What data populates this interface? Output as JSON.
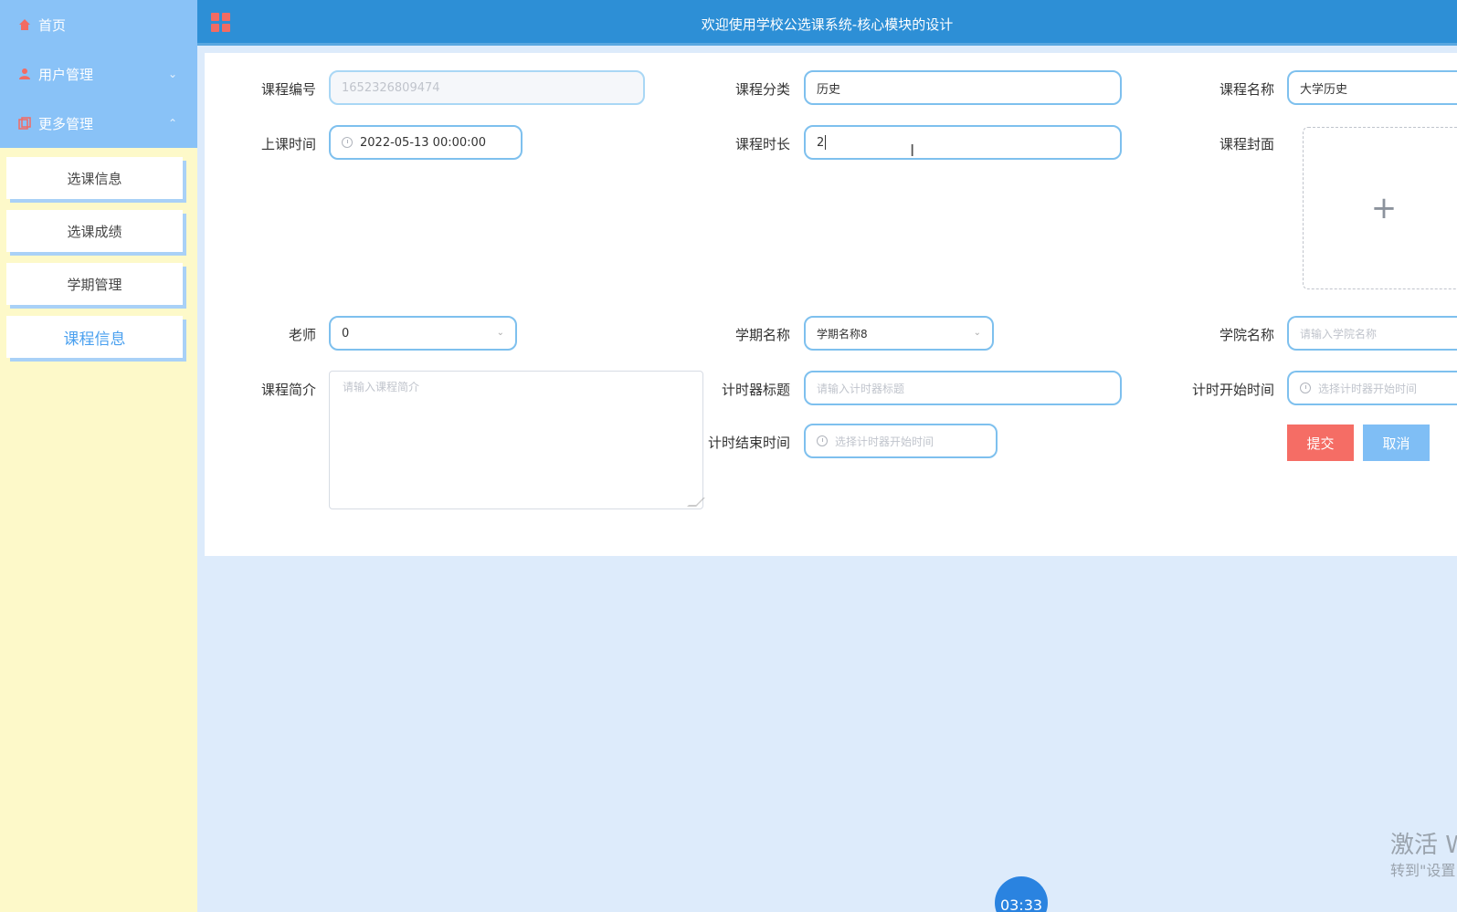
{
  "sidebar": {
    "menu": [
      {
        "label": "首页",
        "icon": "home-icon"
      },
      {
        "label": "用户管理",
        "icon": "user-icon"
      },
      {
        "label": "更多管理",
        "icon": "more-icon"
      }
    ],
    "sub_items": [
      {
        "label": "选课信息"
      },
      {
        "label": "选课成绩"
      },
      {
        "label": "学期管理"
      },
      {
        "label": "课程信息",
        "active": true
      }
    ]
  },
  "header": {
    "title": "欢迎使用学校公选课系统-核心模块的设计"
  },
  "form": {
    "course_no": {
      "label": "课程编号",
      "value": "1652326809474"
    },
    "course_category": {
      "label": "课程分类",
      "value": "历史"
    },
    "course_name": {
      "label": "课程名称",
      "value": "大学历史"
    },
    "class_time": {
      "label": "上课时间",
      "value": "2022-05-13 00:00:00"
    },
    "course_duration": {
      "label": "课程时长",
      "value": "2"
    },
    "course_cover": {
      "label": "课程封面",
      "upload_symbol": "+"
    },
    "teacher": {
      "label": "老师",
      "value": "0"
    },
    "semester_name": {
      "label": "学期名称",
      "value": "学期名称8"
    },
    "college_name": {
      "label": "学院名称",
      "placeholder": "请输入学院名称"
    },
    "course_intro": {
      "label": "课程简介",
      "placeholder": "请输入课程简介"
    },
    "timer_title": {
      "label": "计时器标题",
      "placeholder": "请输入计时器标题"
    },
    "timer_start": {
      "label": "计时开始时间",
      "placeholder": "选择计时器开始时间"
    },
    "timer_end": {
      "label": "计时结束时间",
      "placeholder": "选择计时器开始时间"
    },
    "submit_label": "提交",
    "cancel_label": "取消"
  },
  "watermark": {
    "line1": "激活 W",
    "line2": "转到\"设置"
  },
  "timer": {
    "text": "03:33"
  },
  "colors": {
    "sidebar_top": "#89c2f7",
    "sidebar_bg": "#fdf9c9",
    "header_bg": "#2d8fd6",
    "submit": "#f56d65",
    "cancel": "#7fbef5",
    "field_border": "#7ec0ee"
  }
}
